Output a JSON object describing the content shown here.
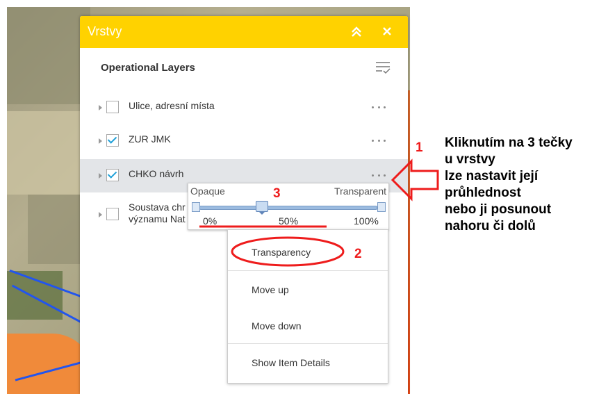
{
  "panel": {
    "title": "Vrstvy",
    "section_title": "Operational Layers",
    "header_color": "#ffd200"
  },
  "layers": [
    {
      "label": "Ulice, adresní místa",
      "checked": false
    },
    {
      "label": "ZUR JMK",
      "checked": true
    },
    {
      "label": "CHKO návrh",
      "checked": true,
      "selected": true
    },
    {
      "label_line1": "Soustava chr",
      "label_line2": "významu Nat",
      "checked": false
    }
  ],
  "slider": {
    "left_label": "Opaque",
    "right_label": "Transparent",
    "ticks": [
      "0%",
      "50%",
      "100%"
    ],
    "value_percent": 35
  },
  "menu": {
    "items": [
      "Transparency",
      "Move up",
      "Move down",
      "Show Item Details"
    ]
  },
  "annotations": {
    "num1": "1",
    "num2": "2",
    "num3": "3",
    "lines": [
      "Kliknutím na 3 tečky",
      "u vrstvy",
      "lze nastavit její",
      "průhlednost",
      "nebo ji posunout",
      "nahoru či dolů"
    ],
    "color": "#ee1c1c"
  }
}
